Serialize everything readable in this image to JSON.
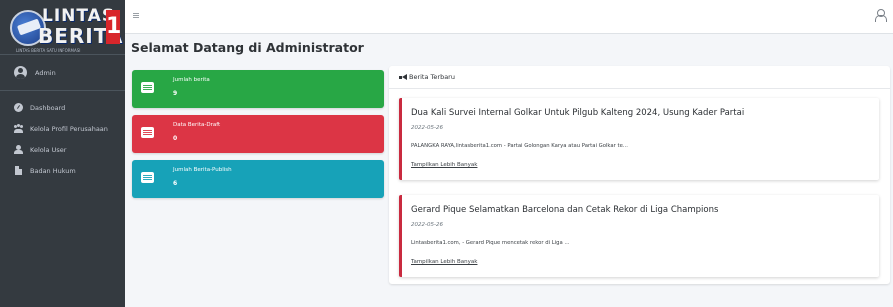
{
  "brand": {
    "logo_line1": "LINTAS",
    "logo_line2": "BERITA",
    "logo_number": "1",
    "logo_tagline": "LINTAS BERITA SATU INFORMASI"
  },
  "user_panel": {
    "name": "Admin"
  },
  "sidebar": {
    "items": [
      {
        "label": "Dashboard",
        "icon": "dashboard-icon"
      },
      {
        "label": "Kelola Profil Perusahaan",
        "icon": "users-icon"
      },
      {
        "label": "Kelola User",
        "icon": "user-icon"
      },
      {
        "label": "Badan Hukum",
        "icon": "file-icon"
      }
    ]
  },
  "page": {
    "title": "Selamat Datang di Administrator"
  },
  "stats": [
    {
      "label": "Jumlah berita",
      "count": "9",
      "color": "#28a745"
    },
    {
      "label": "Data Berita-Draft",
      "count": "0",
      "color": "#dc3545"
    },
    {
      "label": "Jumlah Berita-Publish",
      "count": "6",
      "color": "#17a2b8"
    }
  ],
  "news_panel": {
    "heading": "Berita Terbaru",
    "heading_icon": "megaphone-icon",
    "items": [
      {
        "title": "Dua Kali Survei Internal Golkar Untuk Pilgub Kalteng 2024, Usung Kader Partai",
        "date": "2022-05-26",
        "excerpt": "PALANGKA RAYA,lintasberita1.com - Partai Golongan Karya atau Partai Golkar te...",
        "more_label": "Tampilkan Lebih Banyak"
      },
      {
        "title": "Gerard Pique Selamatkan Barcelona dan Cetak Rekor di Liga Champions",
        "date": "2022-05-26",
        "excerpt": "Lintasberita1.com, - Gerard Pique mencetak rekor di Liga ...",
        "more_label": "Tampilkan Lebih Banyak"
      }
    ]
  },
  "colors": {
    "sidebar_bg": "#343a40",
    "accent_border": "#c92a3f"
  }
}
